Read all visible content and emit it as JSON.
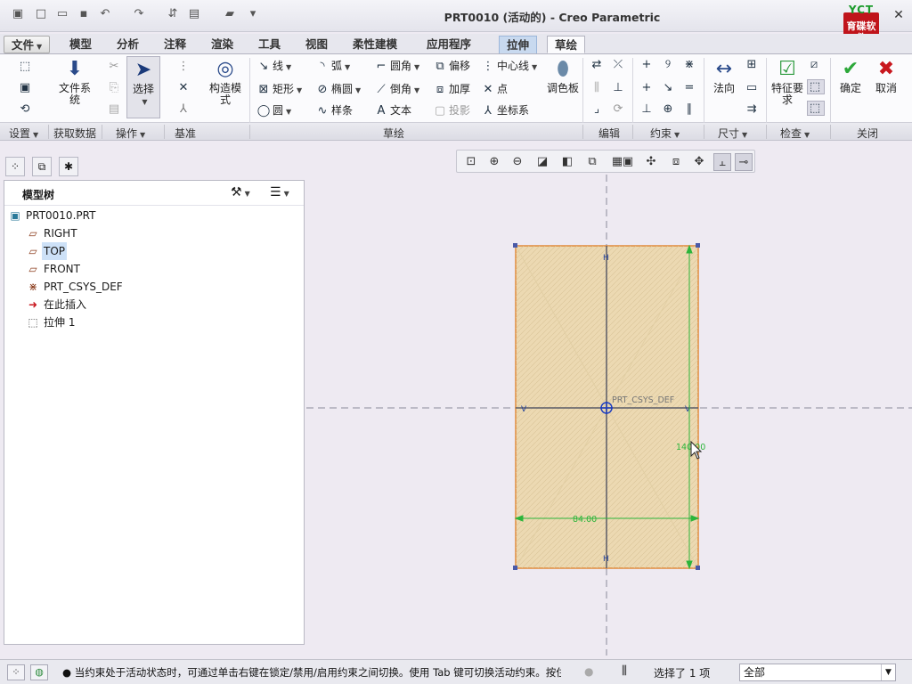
{
  "window": {
    "title": "PRT0010 (活动的) - Creo Parametric",
    "logo_top": "YCT",
    "logo_main": "育碟软件"
  },
  "tabs": [
    "文件",
    "模型",
    "分析",
    "注释",
    "渲染",
    "工具",
    "视图",
    "柔性建模",
    "应用程序",
    "拉伸",
    "草绘"
  ],
  "ribbon": {
    "file_system": "文件系统",
    "select": "选择",
    "construction_mode": "构造模式",
    "line": "线",
    "arc": "弧",
    "fillet": "圆角",
    "offset": "偏移",
    "centerline": "中心线",
    "rectangle": "矩形",
    "ellipse": "椭圆",
    "chamfer": "倒角",
    "thicken": "加厚",
    "point": "点",
    "circle": "圆",
    "spline": "样条",
    "text": "文本",
    "project": "投影",
    "csys": "坐标系",
    "palette": "调色板",
    "normal": "法向",
    "feature_req": "特征要求",
    "ok": "确定",
    "cancel": "取消"
  },
  "groups": [
    "设置",
    "获取数据",
    "操作",
    "基准",
    "草绘",
    "编辑",
    "约束",
    "尺寸",
    "检查",
    "关闭"
  ],
  "tree": {
    "title": "模型树",
    "items": [
      "PRT0010.PRT",
      "RIGHT",
      "TOP",
      "FRONT",
      "PRT_CSYS_DEF",
      "在此插入",
      "拉伸 1"
    ]
  },
  "sketch": {
    "csys_label": "PRT_CSYS_DEF",
    "dim_width": "84.00",
    "dim_height": "140.00"
  },
  "status": {
    "message": "● 当约束处于活动状态时，可通过单击右键在锁定/禁用/启用约束之间切换。使用 Tab 键可切换活动约束。按住",
    "selected": "选择了 1 项",
    "filter": "全部"
  },
  "colors": {
    "sketch_fill": "#ecd9b2",
    "sketch_edge": "#e08a3a",
    "dim": "#2bb53a",
    "accent_tab": "#c8d9ef"
  }
}
